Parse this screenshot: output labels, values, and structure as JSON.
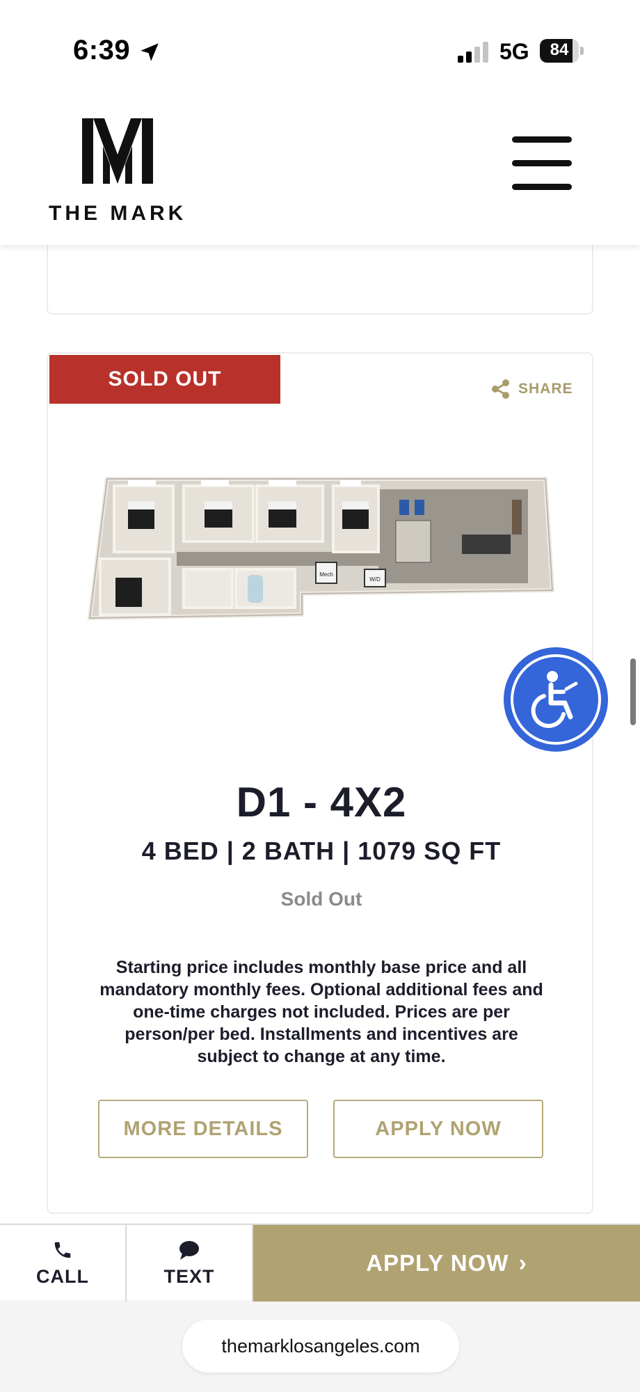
{
  "status_bar": {
    "time": "6:39",
    "network": "5G",
    "battery": "84",
    "battery_level": 0.84
  },
  "header": {
    "logo_text": "THE MARK",
    "menu_icon": "hamburger-menu-icon"
  },
  "card": {
    "badge": "SOLD OUT",
    "share_label": "SHARE",
    "unit_title": "D1 - 4X2",
    "unit_specs": "4 BED | 2 BATH | 1079 SQ FT",
    "unit_status": "Sold Out",
    "disclaimer": "Starting price includes monthly base price and all mandatory monthly fees. Optional additional fees and one-time charges not included. Prices are per person/per bed. Installments and incentives are subject to change at any time.",
    "more_details_label": "MORE DETAILS",
    "apply_label": "APPLY NOW",
    "floorplan_labels": {
      "mech": "Mech",
      "wd": "W/D"
    }
  },
  "action_bar": {
    "call_label": "CALL",
    "text_label": "TEXT",
    "apply_label": "APPLY NOW"
  },
  "browser": {
    "url": "themarklosangeles.com"
  },
  "colors": {
    "gold": "#b1a271",
    "sold_red": "#b8312b",
    "accessibility_blue": "#3465d9",
    "navy_text": "#1c1d2b"
  }
}
